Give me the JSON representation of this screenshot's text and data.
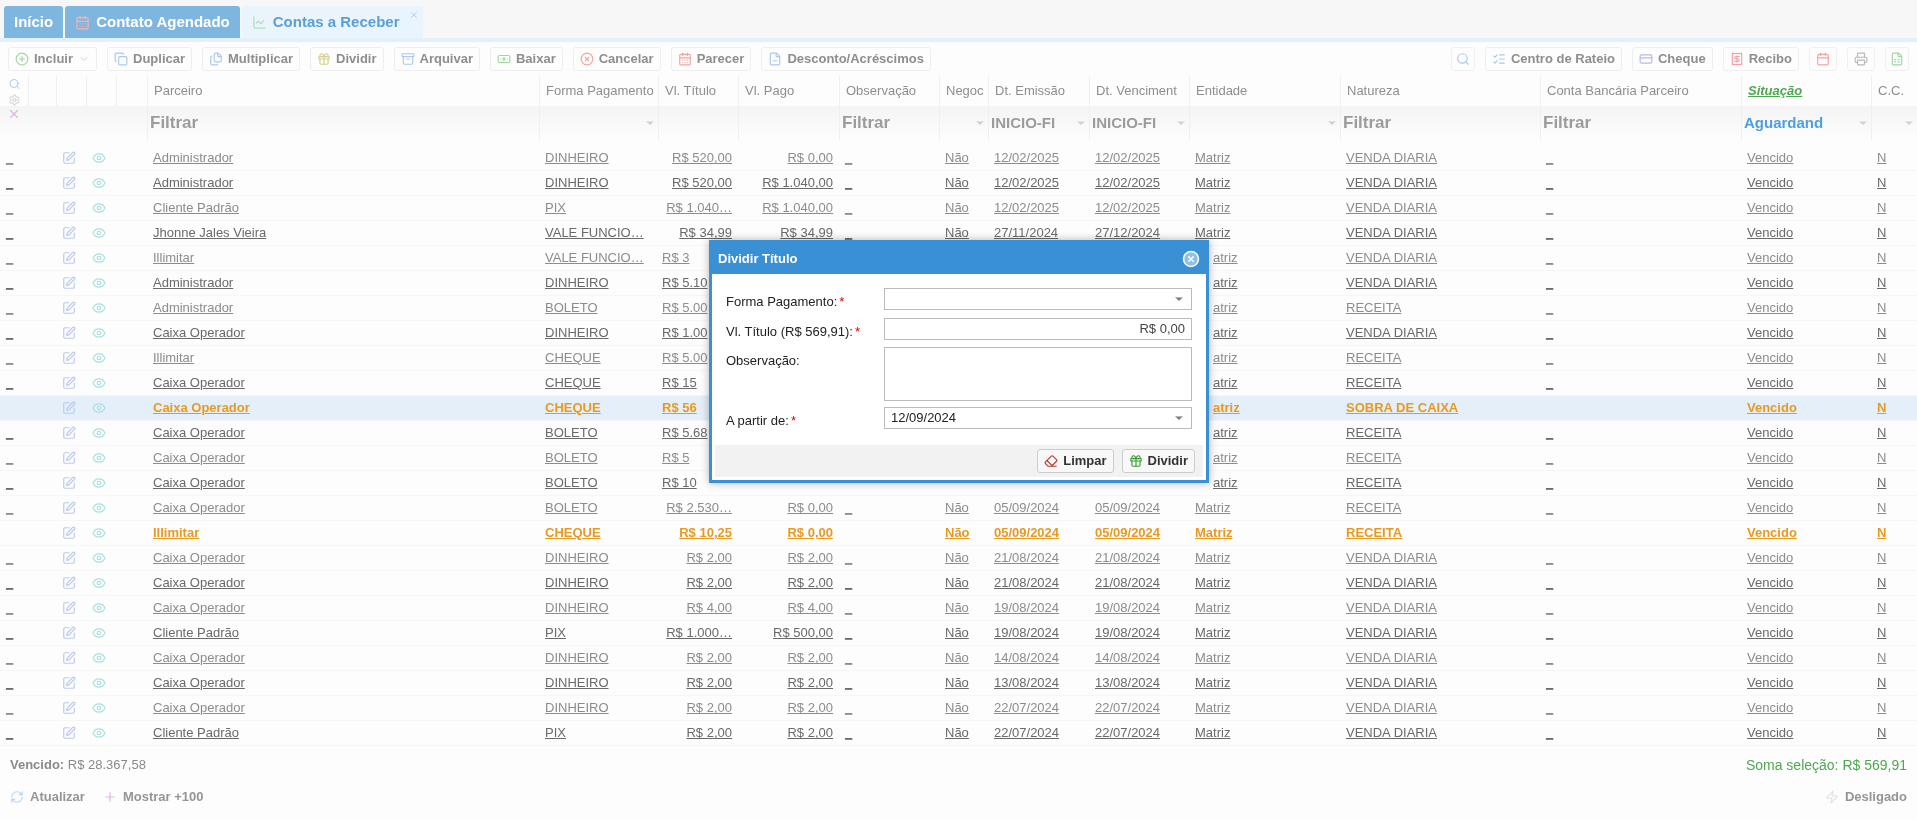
{
  "tabs": [
    {
      "label": "Início",
      "selected": false
    },
    {
      "label": "Contato Agendado",
      "selected": false
    },
    {
      "label": "Contas a Receber",
      "selected": true
    }
  ],
  "toolbar": {
    "left": [
      "Incluir",
      "Duplicar",
      "Multiplicar",
      "Dividir",
      "Arquivar",
      "Baixar",
      "Cancelar",
      "Parecer",
      "Desconto/Acréscimos"
    ],
    "right": [
      "Centro de Rateio",
      "Cheque",
      "Recibo"
    ]
  },
  "table": {
    "columns": [
      {
        "label": "Parceiro",
        "sorted": false
      },
      {
        "label": "Forma Pagamento",
        "sorted": false
      },
      {
        "label": "Vl. Título",
        "sorted": false
      },
      {
        "label": "Vl. Pago",
        "sorted": false
      },
      {
        "label": "Observação",
        "sorted": false
      },
      {
        "label": "Negoc",
        "sorted": false
      },
      {
        "label": "Dt. Emissão",
        "sorted": false
      },
      {
        "label": "Dt. Venciment",
        "sorted": false
      },
      {
        "label": "Entidade",
        "sorted": false
      },
      {
        "label": "Natureza",
        "sorted": false
      },
      {
        "label": "Conta Bancária Parceiro",
        "sorted": false
      },
      {
        "label": "Situação",
        "sorted": true
      },
      {
        "label": "C.C.",
        "sorted": false
      }
    ],
    "filters": [
      {
        "kind": "text",
        "placeholder": "Filtrar"
      },
      {
        "kind": "select"
      },
      {
        "kind": "none"
      },
      {
        "kind": "none"
      },
      {
        "kind": "text",
        "placeholder": "Filtrar"
      },
      {
        "kind": "select"
      },
      {
        "kind": "select",
        "value": "INICIO-FI"
      },
      {
        "kind": "select",
        "value": "INICIO-FI"
      },
      {
        "kind": "select"
      },
      {
        "kind": "text",
        "placeholder": "Filtrar"
      },
      {
        "kind": "text",
        "placeholder": "Filtrar"
      },
      {
        "kind": "select",
        "value": "Aguardand"
      },
      {
        "kind": "select"
      }
    ],
    "rows": [
      {
        "kind": "muted",
        "selected": false,
        "lead": "_",
        "cells": [
          "Administrador",
          "DINHEIRO",
          "R$ 520,00",
          "R$ 0,00",
          "_",
          "Não",
          "12/02/2025",
          "12/02/2025",
          "Matriz",
          "VENDA DIARIA",
          "_",
          "Vencido",
          "N"
        ]
      },
      {
        "kind": "normal",
        "selected": false,
        "lead": "_",
        "cells": [
          "Administrador",
          "DINHEIRO",
          "R$ 520,00",
          "R$ 1.040,00",
          "_",
          "Não",
          "12/02/2025",
          "12/02/2025",
          "Matriz",
          "VENDA DIARIA",
          "_",
          "Vencido",
          "N"
        ]
      },
      {
        "kind": "muted",
        "selected": false,
        "lead": "_",
        "cells": [
          "Cliente Padrão",
          "PIX",
          "R$ 1.040…",
          "R$ 1.040,00",
          "_",
          "Não",
          "12/02/2025",
          "12/02/2025",
          "Matriz",
          "VENDA DIARIA",
          "_",
          "Vencido",
          "N"
        ]
      },
      {
        "kind": "normal",
        "selected": false,
        "lead": "_",
        "cells": [
          "Jhonne Jales Vieira",
          "VALE FUNCIO…",
          "R$ 34,99",
          "R$ 34,99",
          "_",
          "Não",
          "27/11/2024",
          "27/12/2024",
          "Matriz",
          "VENDA DIARIA",
          "_",
          "Vencido",
          "N"
        ]
      },
      {
        "kind": "muted",
        "selected": false,
        "lead": "_",
        "cells": [
          "Illimitar",
          "VALE FUNCIO…",
          "R$ 3",
          null,
          null,
          null,
          null,
          null,
          "atriz",
          "VENDA DIARIA",
          "_",
          "Vencido",
          "N"
        ]
      },
      {
        "kind": "normal",
        "selected": false,
        "lead": "_",
        "cells": [
          "Administrador",
          "DINHEIRO",
          "R$ 5.10",
          null,
          null,
          null,
          null,
          null,
          "atriz",
          "VENDA DIARIA",
          "_",
          "Vencido",
          "N"
        ]
      },
      {
        "kind": "muted",
        "selected": false,
        "lead": "_",
        "cells": [
          "Administrador",
          "BOLETO",
          "R$ 5.00",
          null,
          null,
          null,
          null,
          null,
          "atriz",
          "RECEITA",
          "_",
          "Vencido",
          "N"
        ]
      },
      {
        "kind": "normal",
        "selected": false,
        "lead": "_",
        "cells": [
          "Caixa Operador",
          "DINHEIRO",
          "R$ 1.00",
          null,
          null,
          null,
          null,
          null,
          "atriz",
          "VENDA DIARIA",
          "_",
          "Vencido",
          "N"
        ]
      },
      {
        "kind": "muted",
        "selected": false,
        "lead": "_",
        "cells": [
          "Illimitar",
          "CHEQUE",
          "R$ 5.00",
          null,
          null,
          null,
          null,
          null,
          "atriz",
          "RECEITA",
          "_",
          "Vencido",
          "N"
        ]
      },
      {
        "kind": "normal",
        "selected": false,
        "lead": "_",
        "cells": [
          "Caixa Operador",
          "CHEQUE",
          "R$ 15",
          null,
          null,
          null,
          null,
          null,
          "atriz",
          "RECEITA",
          "_",
          "Vencido",
          "N"
        ]
      },
      {
        "kind": "highlight",
        "selected": true,
        "cells": [
          "Caixa Operador",
          "CHEQUE",
          "R$ 56",
          null,
          null,
          null,
          null,
          null,
          "atriz",
          "SOBRA DE CAIXA",
          null,
          "Vencido",
          "N"
        ]
      },
      {
        "kind": "normal",
        "selected": false,
        "lead": "_",
        "cells": [
          "Caixa Operador",
          "BOLETO",
          "R$ 5.68",
          null,
          null,
          null,
          null,
          null,
          "atriz",
          "RECEITA",
          "_",
          "Vencido",
          "N"
        ]
      },
      {
        "kind": "muted",
        "selected": false,
        "lead": "_",
        "cells": [
          "Caixa Operador",
          "BOLETO",
          "R$ 5",
          null,
          null,
          null,
          null,
          null,
          "atriz",
          "RECEITA",
          "_",
          "Vencido",
          "N"
        ]
      },
      {
        "kind": "normal",
        "selected": false,
        "lead": "_",
        "cells": [
          "Caixa Operador",
          "BOLETO",
          "R$ 10",
          null,
          null,
          null,
          null,
          null,
          "atriz",
          "RECEITA",
          "_",
          "Vencido",
          "N"
        ]
      },
      {
        "kind": "muted",
        "selected": false,
        "lead": "_",
        "cells": [
          "Caixa Operador",
          "BOLETO",
          "R$ 2.530…",
          "R$ 0,00",
          "_",
          "Não",
          "05/09/2024",
          "05/09/2024",
          "Matriz",
          "RECEITA",
          "_",
          "Vencido",
          "N"
        ]
      },
      {
        "kind": "highlight",
        "selected": false,
        "cells": [
          "Illimitar",
          "CHEQUE",
          "R$ 10,25",
          "R$ 0,00",
          null,
          "Não",
          "05/09/2024",
          "05/09/2024",
          "Matriz",
          "RECEITA",
          null,
          "Vencido",
          "N"
        ]
      },
      {
        "kind": "muted",
        "selected": false,
        "lead": "_",
        "cells": [
          "Caixa Operador",
          "DINHEIRO",
          "R$ 2,00",
          "R$ 2,00",
          "_",
          "Não",
          "21/08/2024",
          "21/08/2024",
          "Matriz",
          "VENDA DIARIA",
          "_",
          "Vencido",
          "N"
        ]
      },
      {
        "kind": "normal",
        "selected": false,
        "lead": "_",
        "cells": [
          "Caixa Operador",
          "DINHEIRO",
          "R$ 2,00",
          "R$ 2,00",
          "_",
          "Não",
          "21/08/2024",
          "21/08/2024",
          "Matriz",
          "VENDA DIARIA",
          "_",
          "Vencido",
          "N"
        ]
      },
      {
        "kind": "muted",
        "selected": false,
        "lead": "_",
        "cells": [
          "Caixa Operador",
          "DINHEIRO",
          "R$ 4,00",
          "R$ 4,00",
          "_",
          "Não",
          "19/08/2024",
          "19/08/2024",
          "Matriz",
          "VENDA DIARIA",
          "_",
          "Vencido",
          "N"
        ]
      },
      {
        "kind": "normal",
        "selected": false,
        "lead": "_",
        "cells": [
          "Cliente Padrão",
          "PIX",
          "R$ 1.000…",
          "R$ 500,00",
          "_",
          "Não",
          "19/08/2024",
          "19/08/2024",
          "Matriz",
          "VENDA DIARIA",
          "_",
          "Vencido",
          "N"
        ]
      },
      {
        "kind": "muted",
        "selected": false,
        "lead": "_",
        "cells": [
          "Caixa Operador",
          "DINHEIRO",
          "R$ 2,00",
          "R$ 2,00",
          "_",
          "Não",
          "14/08/2024",
          "14/08/2024",
          "Matriz",
          "VENDA DIARIA",
          "_",
          "Vencido",
          "N"
        ]
      },
      {
        "kind": "normal",
        "selected": false,
        "lead": "_",
        "cells": [
          "Caixa Operador",
          "DINHEIRO",
          "R$ 2,00",
          "R$ 2,00",
          "_",
          "Não",
          "13/08/2024",
          "13/08/2024",
          "Matriz",
          "VENDA DIARIA",
          "_",
          "Vencido",
          "N"
        ]
      },
      {
        "kind": "muted",
        "selected": false,
        "lead": "_",
        "cells": [
          "Caixa Operador",
          "DINHEIRO",
          "R$ 2,00",
          "R$ 2,00",
          "_",
          "Não",
          "22/07/2024",
          "22/07/2024",
          "Matriz",
          "VENDA DIARIA",
          "_",
          "Vencido",
          "N"
        ]
      },
      {
        "kind": "normal",
        "selected": false,
        "lead": "_",
        "cells": [
          "Cliente Padrão",
          "PIX",
          "R$ 2,00",
          "R$ 2,00",
          "_",
          "Não",
          "22/07/2024",
          "22/07/2024",
          "Matriz",
          "VENDA DIARIA",
          "_",
          "Vencido",
          "N"
        ]
      }
    ]
  },
  "summary": {
    "total": "**Vencido:** R$ 28.367,58",
    "selection": "Soma seleção: R$ 569,91"
  },
  "bottom_bar": {
    "buttons": [
      "Atualizar",
      "Mostrar +100"
    ],
    "status": "Desligado"
  },
  "dialog": {
    "title": "Dividir Título",
    "fields": [
      {
        "kind": "select",
        "label": "Forma Pagamento:",
        "required_mark": "*"
      },
      {
        "kind": "text",
        "label": "Vl. Título (R$ 569,91):",
        "required_mark": "*",
        "value": "R$ 0,00"
      },
      {
        "kind": "textarea",
        "label": "Observação:"
      },
      {
        "kind": "select",
        "label": "A partir de:",
        "required_mark": "*",
        "value": "12/09/2024"
      }
    ],
    "buttons": [
      "Limpar",
      "Dividir"
    ]
  }
}
